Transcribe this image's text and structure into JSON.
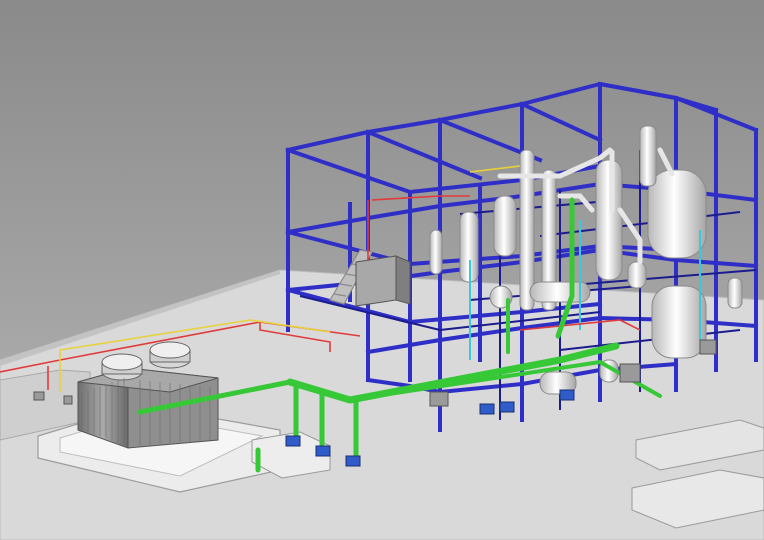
{
  "scene": {
    "description_visible_text": "",
    "colors": {
      "background_top": "#8a8a8a",
      "background_bottom": "#b7b7b7",
      "ground": "#d9d9d9",
      "ground_edge": "#bcbcbc",
      "steel_frame": "#2f2fc8",
      "steel_frame_dark": "#1c1c8e",
      "pipe_green": "#37c837",
      "pipe_red": "#e23a3a",
      "pipe_yellow": "#e8d23a",
      "pipe_cyan": "#39c9d9",
      "vessel_white": "#eeeeee",
      "vessel_shadow": "#b8b8b8",
      "equipment_gray": "#9a9a9a",
      "pump_blue": "#2f5cc8"
    }
  }
}
